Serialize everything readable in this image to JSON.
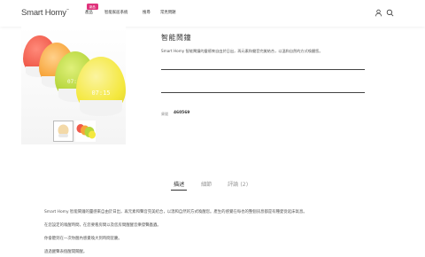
{
  "header": {
    "logo": "Smart Homy",
    "badge": "新品",
    "nav": [
      "產品",
      "智能家居系統",
      "搜尋",
      "常見問題"
    ]
  },
  "product": {
    "title": "智能鬧鐘",
    "description": "Smart Homy 智能鬧鐘的靈感來自由於日出，再元素和聲音完美結合，以溫和自然的方式喚醒您。",
    "sku_label": "貨號",
    "sku_value": "460569",
    "lamp_clock_text": "07:15"
  },
  "tabs": [
    {
      "label": "描述",
      "active": true
    },
    {
      "label": "細節",
      "active": false
    },
    {
      "label": "評論 (2)",
      "active": false
    }
  ],
  "content": {
    "paragraphs": [
      "Smart Homy 智能鬧鐘的靈感來自由於日出，再元素和聲音完美結合，以溫和自然的方式喚醒您。產生的感覺在每也的整個訊息都是有種愛從起床氣息。",
      "在您設定的喚醒時間，在您要看房間以及您房間醒醒音樂發聲蟲蟲。",
      "你會聽到在一次你醒內感覺喚大到時間室慶。",
      "過過醒聲表個醒開關醒。"
    ]
  },
  "colors": {
    "accent": "#e0337c",
    "text": "#333333",
    "lamp_red": "#f05a4a",
    "lamp_orange": "#f7a43a",
    "lamp_lime": "#b6d63c",
    "lamp_yellow": "#f4e83e"
  },
  "icons": [
    "user-icon",
    "search-icon"
  ]
}
